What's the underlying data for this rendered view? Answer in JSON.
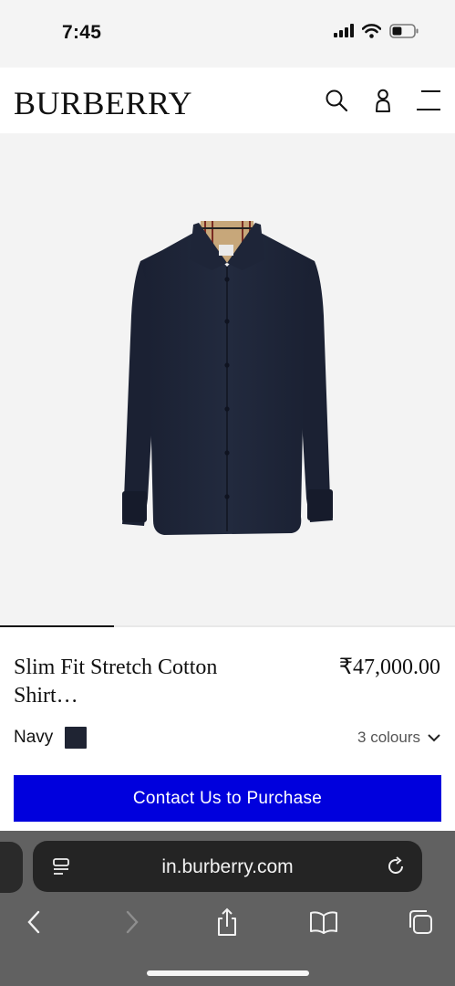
{
  "status_bar": {
    "time": "7:45",
    "icons": [
      "signal-icon",
      "wifi-icon",
      "battery-icon"
    ],
    "battery_level": 0.45
  },
  "header": {
    "logo": "BURBERRY",
    "icons": [
      "search-icon",
      "account-icon",
      "menu-icon"
    ]
  },
  "gallery": {
    "image": "shirt-product-image",
    "progress": 0.25
  },
  "product": {
    "name": "Slim Fit Stretch Cotton Shirt…",
    "price": "₹47,000.00",
    "colour": "Navy",
    "swatch_color": "#1f2433",
    "colours_link": "3 colours"
  },
  "cta": {
    "label": "Contact Us to Purchase",
    "color": "#0000dd"
  },
  "browser": {
    "url": "in.burberry.com",
    "icons": [
      "page-menu-icon",
      "reload-icon",
      "back-icon",
      "forward-icon",
      "share-icon",
      "bookmarks-icon",
      "tabs-icon"
    ]
  }
}
